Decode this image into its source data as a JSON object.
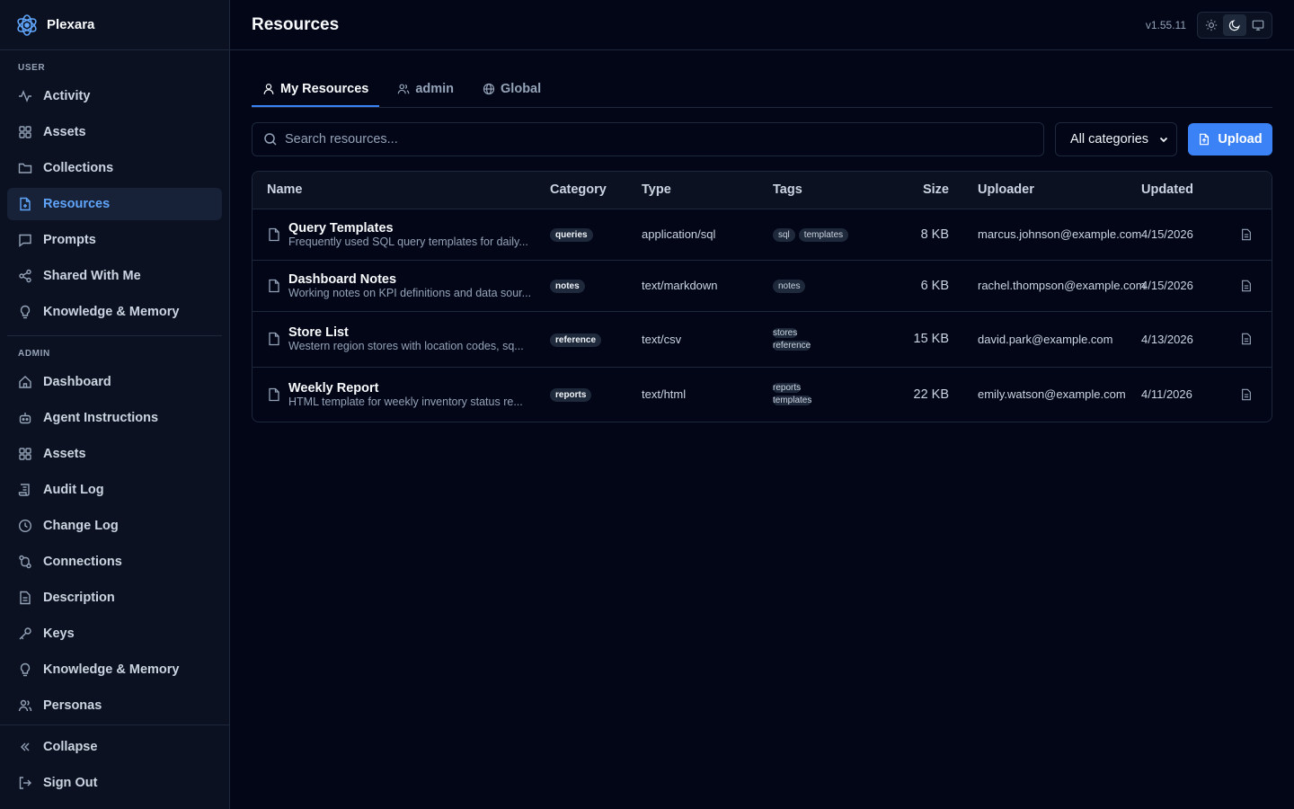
{
  "app": {
    "name": "Plexara",
    "version": "v1.55.11"
  },
  "sidebar": {
    "user_label": "USER",
    "user_items": [
      {
        "label": "Activity",
        "icon": "activity-icon"
      },
      {
        "label": "Assets",
        "icon": "grid-icon"
      },
      {
        "label": "Collections",
        "icon": "folder-icon"
      },
      {
        "label": "Resources",
        "icon": "file-icon",
        "active": true
      },
      {
        "label": "Prompts",
        "icon": "message-icon"
      },
      {
        "label": "Shared With Me",
        "icon": "share-icon"
      },
      {
        "label": "Knowledge & Memory",
        "icon": "lightbulb-icon"
      }
    ],
    "admin_label": "ADMIN",
    "admin_items": [
      {
        "label": "Dashboard",
        "icon": "home-icon"
      },
      {
        "label": "Agent Instructions",
        "icon": "bot-icon"
      },
      {
        "label": "Assets",
        "icon": "grid-icon"
      },
      {
        "label": "Audit Log",
        "icon": "scroll-icon"
      },
      {
        "label": "Change Log",
        "icon": "clock-icon"
      },
      {
        "label": "Connections",
        "icon": "connections-icon"
      },
      {
        "label": "Description",
        "icon": "document-icon"
      },
      {
        "label": "Keys",
        "icon": "key-icon"
      },
      {
        "label": "Knowledge & Memory",
        "icon": "lightbulb-icon"
      },
      {
        "label": "Personas",
        "icon": "users-icon"
      }
    ],
    "footer": {
      "collapse_label": "Collapse",
      "signout_label": "Sign Out"
    }
  },
  "header": {
    "title": "Resources"
  },
  "tabs": [
    {
      "label": "My Resources",
      "icon": "user-icon",
      "active": true
    },
    {
      "label": "admin",
      "icon": "users-icon"
    },
    {
      "label": "Global",
      "icon": "globe-icon"
    }
  ],
  "toolbar": {
    "search_placeholder": "Search resources...",
    "category_selected": "All categories",
    "upload_label": "Upload"
  },
  "table": {
    "columns": [
      "Name",
      "Category",
      "Type",
      "Tags",
      "Size",
      "Uploader",
      "Updated"
    ],
    "rows": [
      {
        "name": "Query Templates",
        "description": "Frequently used SQL query templates for daily...",
        "category": "queries",
        "type": "application/sql",
        "tags": [
          "sql",
          "templates"
        ],
        "size": "8 KB",
        "uploader": "marcus.johnson@example.com",
        "updated": "4/15/2026"
      },
      {
        "name": "Dashboard Notes",
        "description": "Working notes on KPI definitions and data sour...",
        "category": "notes",
        "type": "text/markdown",
        "tags": [
          "notes"
        ],
        "size": "6 KB",
        "uploader": "rachel.thompson@example.com",
        "updated": "4/15/2026"
      },
      {
        "name": "Store List",
        "description": "Western region stores with location codes, sq...",
        "category": "reference",
        "type": "text/csv",
        "tags": [
          "stores",
          "reference"
        ],
        "size": "15 KB",
        "uploader": "david.park@example.com",
        "updated": "4/13/2026"
      },
      {
        "name": "Weekly Report",
        "description": "HTML template for weekly inventory status re...",
        "category": "reports",
        "type": "text/html",
        "tags": [
          "reports",
          "templates"
        ],
        "size": "22 KB",
        "uploader": "emily.watson@example.com",
        "updated": "4/11/2026"
      }
    ]
  },
  "colors": {
    "background": "#020617",
    "sidebar": "#0b1120",
    "border": "#1e293b",
    "accent": "#3b82f6",
    "active_text": "#60a5fa"
  }
}
